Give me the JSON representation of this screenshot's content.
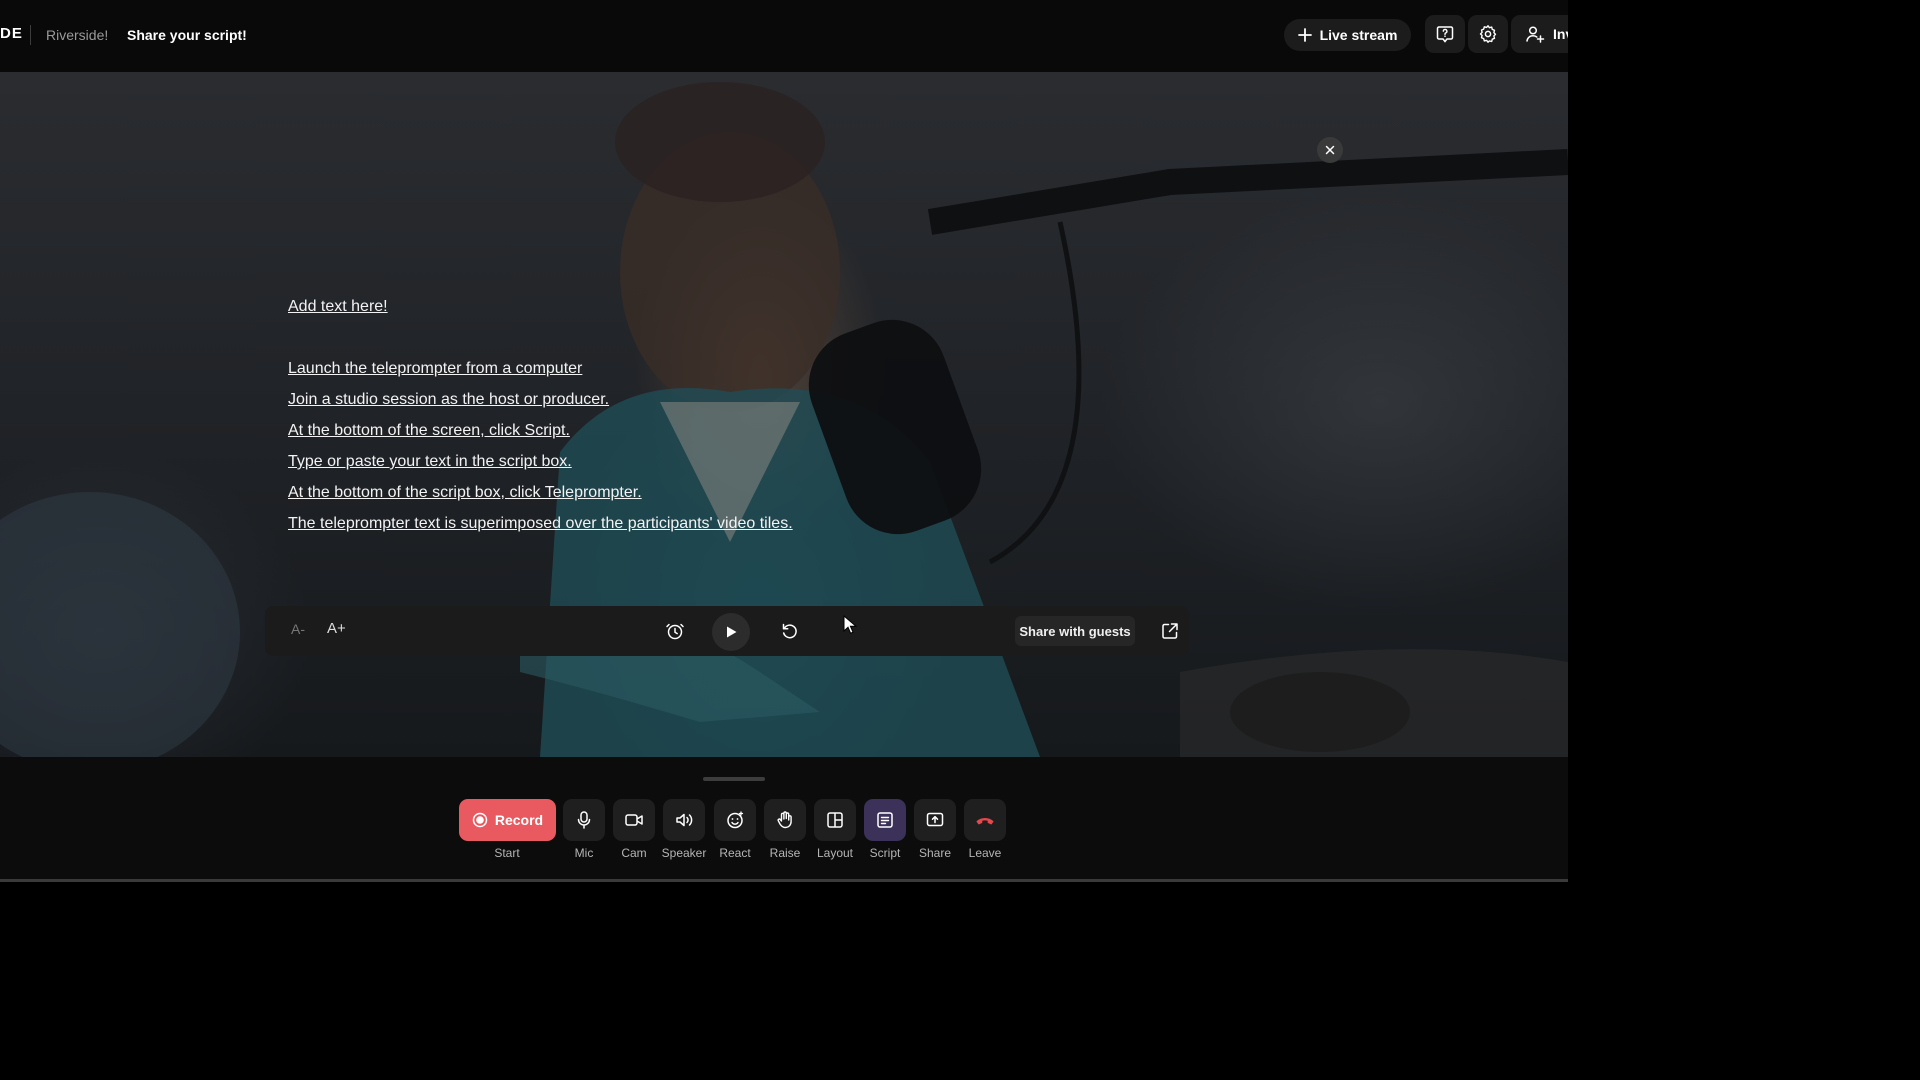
{
  "header": {
    "brand": "DE",
    "studio_name": "Riverside!",
    "session_title": "Share your script!",
    "live_stream_label": "Live stream",
    "invite_label": "Invite"
  },
  "script": {
    "lines": [
      "Add text here!",
      "",
      "Launch the teleprompter from a computer",
      "Join a studio session as the host or producer.",
      "At the bottom of the screen, click  Script.",
      "Type or paste your text in the script box.",
      "At the bottom of the script box, click Teleprompter.",
      "The teleprompter text is superimposed over the participants' video tiles."
    ]
  },
  "teleprompter": {
    "decrease_font_label": "A-",
    "increase_font_label": "A+",
    "share_with_guests_label": "Share with guests"
  },
  "controls": {
    "record_label": "Record",
    "start_label": "Start",
    "mic_label": "Mic",
    "cam_label": "Cam",
    "speaker_label": "Speaker",
    "react_label": "React",
    "raise_label": "Raise",
    "layout_label": "Layout",
    "script_label": "Script",
    "share_label": "Share",
    "leave_label": "Leave"
  },
  "colors": {
    "record": "#e85a5f",
    "script_active": "#3b3159",
    "leave_icon": "#e5484d"
  }
}
